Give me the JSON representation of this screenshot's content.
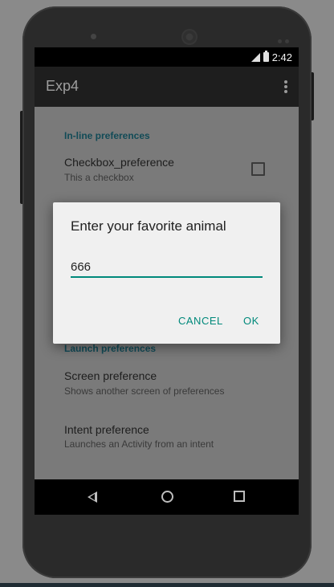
{
  "status_bar": {
    "time": "2:42",
    "icons": [
      "signal-icon",
      "battery-icon"
    ]
  },
  "app_bar": {
    "title": "Exp4",
    "menu_icon": "overflow-menu-icon"
  },
  "preferences": {
    "inline_header": "In-line preferences",
    "checkbox": {
      "title": "Checkbox_preference",
      "summary": "This a checkbox",
      "checked": false
    },
    "launch_header": "Launch preferences",
    "screen": {
      "title": "Screen preference",
      "summary": "Shows another screen of preferences"
    },
    "intent": {
      "title": "Intent preference",
      "summary": "Launches an Activity from an intent"
    }
  },
  "dialog": {
    "title": "Enter your favorite animal",
    "input_value": "666",
    "cancel_label": "CANCEL",
    "ok_label": "OK"
  },
  "nav_bar": {
    "icons": [
      "back-icon",
      "home-icon",
      "recents-icon"
    ]
  },
  "colors": {
    "accent": "#00897b",
    "header": "#124b57"
  }
}
